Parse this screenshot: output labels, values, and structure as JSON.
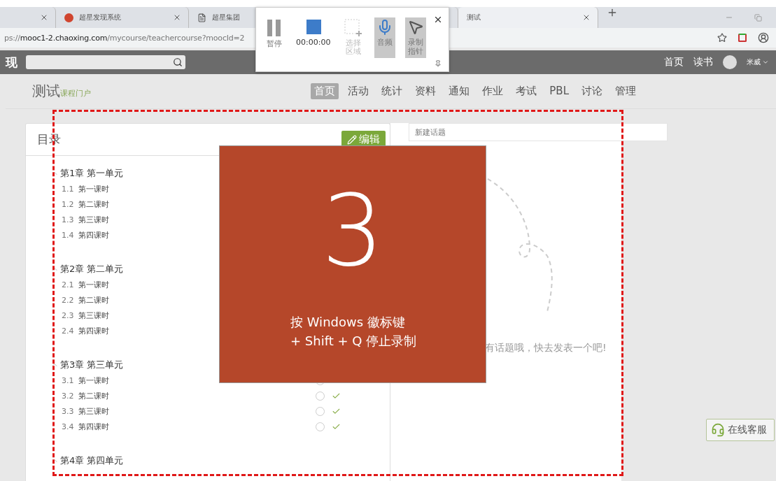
{
  "browser": {
    "tabs": [
      {
        "kind": "plain",
        "selected": false
      },
      {
        "kind": "site",
        "title": "超星发现系统",
        "selected": false
      },
      {
        "kind": "document",
        "title": "超星集团",
        "selected": false
      },
      {
        "kind": "plain",
        "title": "测试",
        "selected": true
      }
    ],
    "address": {
      "scheme": "ps://",
      "host": "mooc1-2.chaoxing.com",
      "path": "/mycourse/teachercourse?moocId=2"
    }
  },
  "site_bar": {
    "logo_fragment": "现",
    "links": [
      "首页",
      "读书"
    ],
    "user": "米威"
  },
  "course": {
    "title": "测试",
    "subtitle": "课程门户",
    "nav": [
      {
        "label": "首页",
        "selected": true
      },
      {
        "label": "活动",
        "selected": false
      },
      {
        "label": "统计",
        "selected": false
      },
      {
        "label": "资料",
        "selected": false
      },
      {
        "label": "通知",
        "selected": false
      },
      {
        "label": "作业",
        "selected": false
      },
      {
        "label": "考试",
        "selected": false
      },
      {
        "label": "PBL",
        "selected": false
      },
      {
        "label": "讨论",
        "selected": false
      },
      {
        "label": "管理",
        "selected": false
      }
    ]
  },
  "catalog": {
    "title": "目录",
    "edit_button": "编辑",
    "chapters": [
      {
        "title": "第1章 第一单元",
        "expanded": true,
        "children": [
          {
            "number": "1.1",
            "title": "第一课时"
          },
          {
            "number": "1.2",
            "title": "第二课时"
          },
          {
            "number": "1.3",
            "title": "第三课时"
          },
          {
            "number": "1.4",
            "title": "第四课时"
          }
        ]
      },
      {
        "title": "第2章 第二单元",
        "expanded": true,
        "children": [
          {
            "number": "2.1",
            "title": "第一课时"
          },
          {
            "number": "2.2",
            "title": "第二课时"
          },
          {
            "number": "2.3",
            "title": "第三课时"
          },
          {
            "number": "2.4",
            "title": "第四课时"
          }
        ]
      },
      {
        "title": "第3章 第三单元",
        "expanded": true,
        "children": [
          {
            "number": "3.1",
            "title": "第一课时",
            "marks": true
          },
          {
            "number": "3.2",
            "title": "第二课时",
            "marks": true
          },
          {
            "number": "3.3",
            "title": "第三课时",
            "marks": true
          },
          {
            "number": "3.4",
            "title": "第四课时",
            "marks": true
          }
        ]
      },
      {
        "title": "第4章 第四单元",
        "expanded": true
      }
    ]
  },
  "discussion": {
    "placeholder": "新建话题",
    "empty_text": "有话题哦，快去发表一个吧!"
  },
  "support_button": "在线客服",
  "recorder": {
    "buttons": [
      {
        "kind": "pause",
        "label": "暂停",
        "on": false,
        "disabled": false
      },
      {
        "kind": "stop",
        "label": "00:00:00",
        "on": false,
        "disabled": false
      },
      {
        "kind": "region",
        "label": "选择区域",
        "on": false,
        "disabled": true
      },
      {
        "kind": "audio",
        "label": "音频",
        "on": true,
        "disabled": false
      },
      {
        "kind": "pointer",
        "label": "录制指针",
        "on": true,
        "disabled": false
      }
    ]
  },
  "countdown": {
    "number": "3",
    "lines": [
      "按 Windows 徽标键",
      "+ Shift + Q 停止录制"
    ]
  }
}
